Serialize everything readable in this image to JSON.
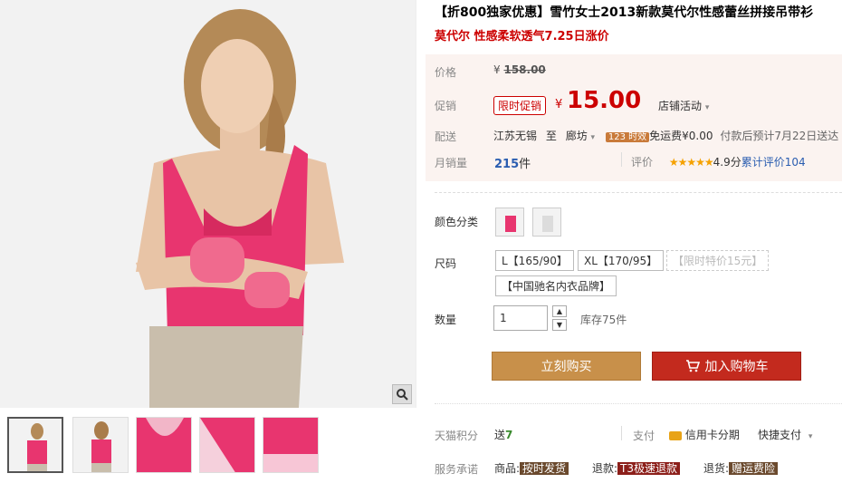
{
  "product": {
    "title": "【折800独家优惠】雪竹女士2013新款莫代尔性感蕾丝拼接吊带衫",
    "subtitle": "莫代尔 性感柔软透气7.25日涨价",
    "labels": {
      "price": "价格",
      "promo": "促销",
      "delivery": "配送",
      "monthly_sales": "月销量",
      "rating": "评价",
      "color": "颜色分类",
      "size": "尺码",
      "quantity": "数量",
      "points": "天猫积分",
      "payment": "支付",
      "service": "服务承诺"
    },
    "original_price": "158.00",
    "currency": "¥",
    "promo_tag": "限时促销",
    "price": "15.00",
    "shop_activity": "店铺活动",
    "ship_from": "江苏无锡",
    "ship_to_word": "至",
    "ship_to": "廊坊",
    "ship_chip": "123 时效",
    "ship_fee": "免运费¥0.00",
    "ship_eta": "付款后预计7月22日送达",
    "sold_count": "215",
    "sold_unit": "件",
    "stars": "★★★★★",
    "score": "4.9分",
    "review_link": "累计评价104",
    "sizes": [
      "L【165/90】",
      "XL【170/95】",
      "【限时特价15元】",
      "【中国驰名内衣品牌】"
    ],
    "quantity_value": "1",
    "stock": "库存75件",
    "buy_now": "立刻购买",
    "add_cart": "加入购物车",
    "points_text": "送",
    "points_value": "7",
    "pay_credit": "信用卡分期",
    "pay_quick": "快捷支付",
    "service_items": [
      {
        "prefix": "商品:",
        "tag": "按时发货"
      },
      {
        "prefix": "退款:",
        "tag": "T3极速退款"
      },
      {
        "prefix": "退货:",
        "tag": "赠运费险"
      }
    ]
  },
  "colors": {
    "price_red": "#cc0000",
    "buy_now_bg": "#c8904a",
    "add_cart_bg": "#c32a1e",
    "product_pink": "#e8356f"
  },
  "icons": [
    "zoom-icon",
    "cart-icon",
    "chevron-down-icon",
    "credit-card-icon"
  ]
}
